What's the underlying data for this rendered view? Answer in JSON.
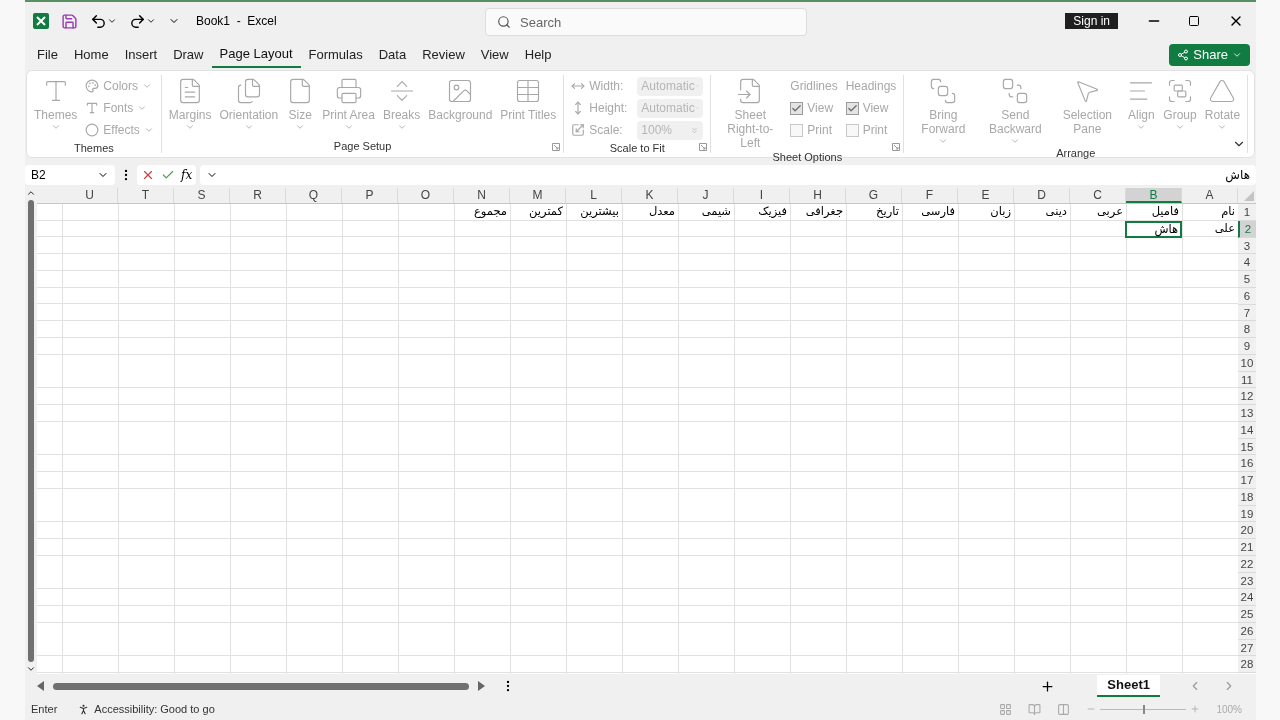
{
  "title_bar": {
    "title": "Book1  -  Excel",
    "search": {
      "placeholder": "Search"
    },
    "sign_in": "Sign in"
  },
  "menu": [
    {
      "label": "File",
      "selected": false
    },
    {
      "label": "Home",
      "selected": false
    },
    {
      "label": "Insert",
      "selected": false
    },
    {
      "label": "Draw",
      "selected": false
    },
    {
      "label": "Page Layout",
      "selected": true
    },
    {
      "label": "Formulas",
      "selected": false
    },
    {
      "label": "Data",
      "selected": false
    },
    {
      "label": "Review",
      "selected": false
    },
    {
      "label": "View",
      "selected": false
    },
    {
      "label": "Help",
      "selected": false
    }
  ],
  "share": "Share",
  "ribbon": {
    "disabled": true,
    "groups": [
      {
        "title": "Themes",
        "launcher": false,
        "items": [
          {
            "kind": "large",
            "label": "Themes",
            "caret": true
          },
          {
            "kind": "stack",
            "items": [
              {
                "kind": "small",
                "label": "Colors"
              },
              {
                "kind": "small",
                "label": "Fonts"
              },
              {
                "kind": "small",
                "label": "Effects"
              }
            ]
          }
        ]
      },
      {
        "title": "Page Setup",
        "launcher": true,
        "items": [
          {
            "kind": "large",
            "label": "Margins",
            "caret": true
          },
          {
            "kind": "large",
            "label": "Orientation",
            "caret": true
          },
          {
            "kind": "large",
            "label": "Size",
            "caret": true
          },
          {
            "kind": "large",
            "label": "Print Area",
            "caret": true
          },
          {
            "kind": "large",
            "label": "Breaks",
            "caret": true
          },
          {
            "kind": "large",
            "label": "Background",
            "caret": false
          },
          {
            "kind": "large",
            "label": "Print Titles",
            "caret": false
          }
        ]
      },
      {
        "title": "Scale to Fit",
        "launcher": true,
        "items": [
          {
            "kind": "stack",
            "items": [
              {
                "kind": "field",
                "label": "Width:",
                "value": "Automatic"
              },
              {
                "kind": "field",
                "label": "Height:",
                "value": "Automatic"
              },
              {
                "kind": "spin",
                "label": "Scale:",
                "value": "100%"
              }
            ]
          }
        ]
      },
      {
        "title": "Sheet Options",
        "launcher": true,
        "items": [
          {
            "kind": "large",
            "label": "Sheet Right-to-Left",
            "caret": false
          },
          {
            "kind": "stack",
            "items": [
              {
                "kind": "heading",
                "label": "Gridlines"
              },
              {
                "kind": "check",
                "label": "View",
                "checked": true
              },
              {
                "kind": "check",
                "label": "Print",
                "checked": false
              }
            ]
          },
          {
            "kind": "stack",
            "items": [
              {
                "kind": "heading",
                "label": "Headings"
              },
              {
                "kind": "check",
                "label": "View",
                "checked": true
              },
              {
                "kind": "check",
                "label": "Print",
                "checked": false
              }
            ]
          }
        ]
      },
      {
        "title": "Arrange",
        "launcher": false,
        "items": [
          {
            "kind": "large",
            "label": "Bring Forward",
            "caret": true
          },
          {
            "kind": "large",
            "label": "Send Backward",
            "caret": true
          },
          {
            "kind": "large",
            "label": "Selection Pane",
            "caret": false
          },
          {
            "kind": "large",
            "label": "Align",
            "caret": true
          },
          {
            "kind": "large",
            "label": "Group",
            "caret": true
          },
          {
            "kind": "large",
            "label": "Rotate",
            "caret": true
          }
        ]
      }
    ]
  },
  "formula_bar": {
    "name_box": "B2",
    "function_label": "fx",
    "content": "هاش"
  },
  "columns": [
    {
      "label": "U",
      "selected": false
    },
    {
      "label": "T",
      "selected": false
    },
    {
      "label": "S",
      "selected": false
    },
    {
      "label": "R",
      "selected": false
    },
    {
      "label": "Q",
      "selected": false
    },
    {
      "label": "P",
      "selected": false
    },
    {
      "label": "O",
      "selected": false
    },
    {
      "label": "N",
      "selected": false
    },
    {
      "label": "M",
      "selected": false
    },
    {
      "label": "L",
      "selected": false
    },
    {
      "label": "K",
      "selected": false
    },
    {
      "label": "J",
      "selected": false
    },
    {
      "label": "I",
      "selected": false
    },
    {
      "label": "H",
      "selected": false
    },
    {
      "label": "G",
      "selected": false
    },
    {
      "label": "F",
      "selected": false
    },
    {
      "label": "E",
      "selected": false
    },
    {
      "label": "D",
      "selected": false
    },
    {
      "label": "C",
      "selected": false
    },
    {
      "label": "B",
      "selected": true
    },
    {
      "label": "A",
      "selected": false
    }
  ],
  "rows": [
    {
      "label": "1",
      "selected": false,
      "cells": [
        "نام",
        "فامیل",
        "عربی",
        "دینی",
        "زبان",
        "فارسی",
        "تاریخ",
        "جغرافی",
        "فیزیک",
        "شیمی",
        "معدل",
        "بیشترین",
        "کمترین",
        "مجموع"
      ]
    },
    {
      "label": "2",
      "selected": true,
      "cells": [
        "علی",
        "هاش"
      ]
    },
    {
      "label": "3",
      "selected": false
    },
    {
      "label": "4",
      "selected": false
    },
    {
      "label": "5",
      "selected": false
    },
    {
      "label": "6",
      "selected": false
    },
    {
      "label": "7",
      "selected": false
    },
    {
      "label": "8",
      "selected": false
    },
    {
      "label": "9",
      "selected": false
    },
    {
      "label": "10",
      "selected": false
    },
    {
      "label": "11",
      "selected": false
    },
    {
      "label": "12",
      "selected": false
    },
    {
      "label": "13",
      "selected": false
    },
    {
      "label": "14",
      "selected": false
    },
    {
      "label": "15",
      "selected": false
    },
    {
      "label": "16",
      "selected": false
    },
    {
      "label": "17",
      "selected": false
    },
    {
      "label": "18",
      "selected": false
    },
    {
      "label": "19",
      "selected": false
    },
    {
      "label": "20",
      "selected": false
    },
    {
      "label": "21",
      "selected": false
    },
    {
      "label": "22",
      "selected": false
    },
    {
      "label": "23",
      "selected": false
    },
    {
      "label": "24",
      "selected": false
    },
    {
      "label": "25",
      "selected": false
    },
    {
      "label": "26",
      "selected": false
    },
    {
      "label": "27",
      "selected": false
    },
    {
      "label": "28",
      "selected": false
    }
  ],
  "sheet_tabs": [
    {
      "label": "Sheet1",
      "selected": true
    }
  ],
  "status_bar": {
    "mode": "Enter",
    "accessibility": "Accessibility: Good to go",
    "zoom": {
      "level": 0.5,
      "reading": "100%"
    }
  }
}
